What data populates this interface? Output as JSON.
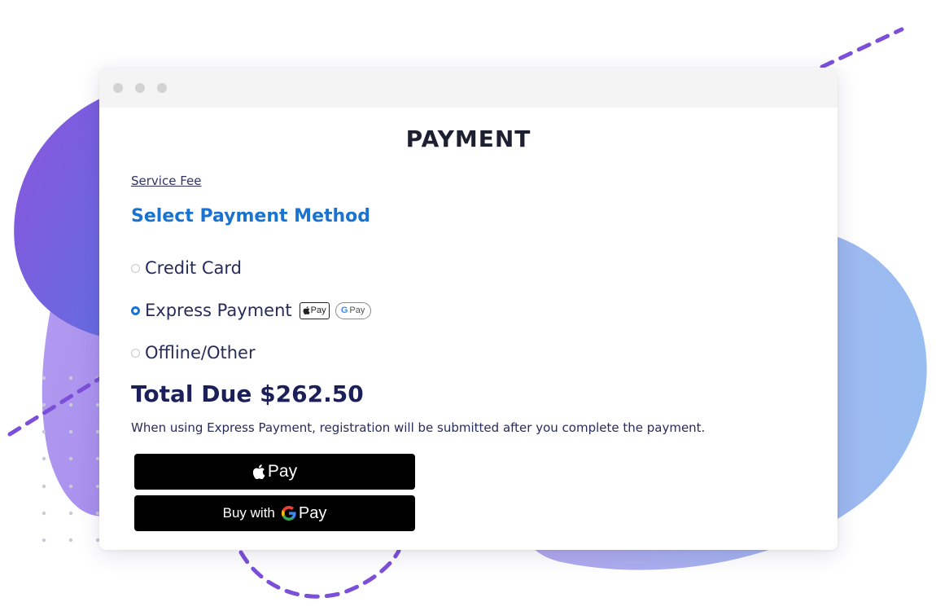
{
  "page": {
    "title": "PAYMENT",
    "service_fee_link": "Service Fee",
    "section_heading": "Select Payment Method"
  },
  "payment_options": [
    {
      "label": "Credit Card",
      "selected": false
    },
    {
      "label": "Express Payment",
      "selected": true
    },
    {
      "label": "Offline/Other",
      "selected": false
    }
  ],
  "badges": {
    "apple_pay": "Pay",
    "google_pay": "Pay"
  },
  "total": {
    "text": "Total Due $262.50"
  },
  "note": "When using Express Payment, registration will be submitted after you complete the payment.",
  "buttons": {
    "apple_pay_label": "Pay",
    "google_pay_prefix": "Buy with",
    "google_pay_label": "Pay"
  },
  "colors": {
    "accent": "#1a72d1",
    "text_dark": "#1c2058",
    "button_bg": "#000000",
    "blob_purple": "#7b57d8",
    "blob_blue": "#9cb9ef"
  },
  "icons": {
    "window_controls": [
      "window-dot-icon",
      "window-dot-icon",
      "window-dot-icon"
    ],
    "apple": "apple-logo-icon",
    "google": "google-g-icon"
  }
}
